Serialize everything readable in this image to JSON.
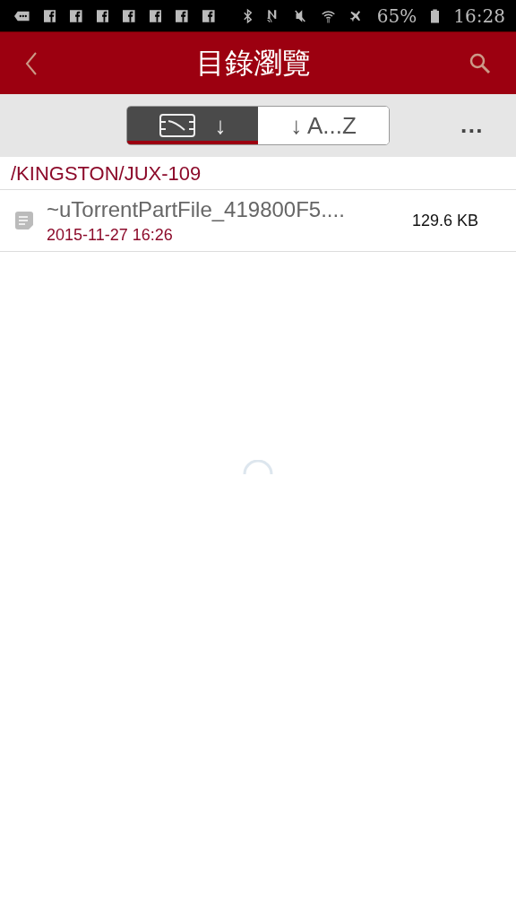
{
  "status_bar": {
    "battery": "65%",
    "time": "16:28",
    "notifications": [
      {
        "kind": "message"
      },
      {
        "kind": "facebook"
      },
      {
        "kind": "facebook"
      },
      {
        "kind": "facebook"
      },
      {
        "kind": "facebook"
      },
      {
        "kind": "facebook"
      },
      {
        "kind": "facebook"
      },
      {
        "kind": "facebook"
      }
    ]
  },
  "header": {
    "title": "目錄瀏覽"
  },
  "sort_tabs": [
    {
      "label": "↓",
      "kind": "date",
      "selected": true
    },
    {
      "label": "↓ A...Z",
      "kind": "name",
      "selected": false
    }
  ],
  "more_button": {
    "label": "···"
  },
  "path": "/KINGSTON/JUX-109",
  "files": [
    {
      "name": "~uTorrentPartFile_419800F5....",
      "date": "2015-11-27 16:26",
      "size": "129.6 KB"
    }
  ]
}
